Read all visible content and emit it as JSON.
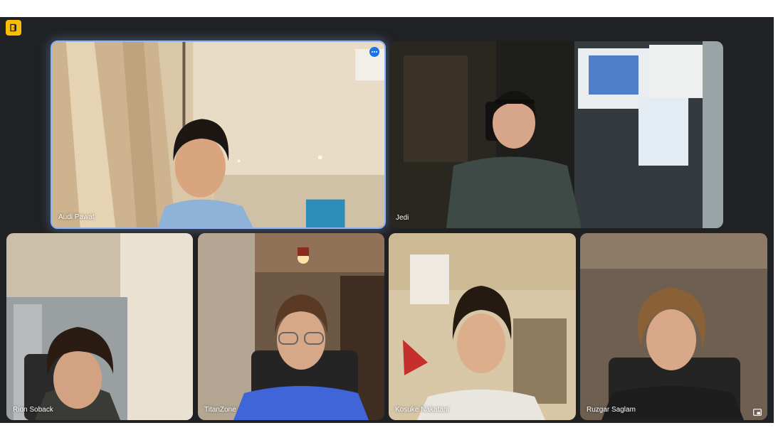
{
  "meeting": {
    "top_icon": "exit-door-icon",
    "participants": [
      {
        "name": "Audi Pawat",
        "active_speaker": true,
        "has_more_options": true
      },
      {
        "name": "Jedi"
      },
      {
        "name": "Rion Soback"
      },
      {
        "name": "TitanZone"
      },
      {
        "name": "Kosuke Nakatani"
      },
      {
        "name": "Ruzgar Saglam",
        "has_pip_control": true
      }
    ]
  },
  "colors": {
    "stage_bg": "#202124",
    "active_border": "#8ab4f8",
    "top_icon_bg": "#fbbc04",
    "more_button_bg": "#1a73e8"
  },
  "icons": {
    "more_options": "more-options-icon",
    "pip": "picture-in-picture-icon"
  }
}
